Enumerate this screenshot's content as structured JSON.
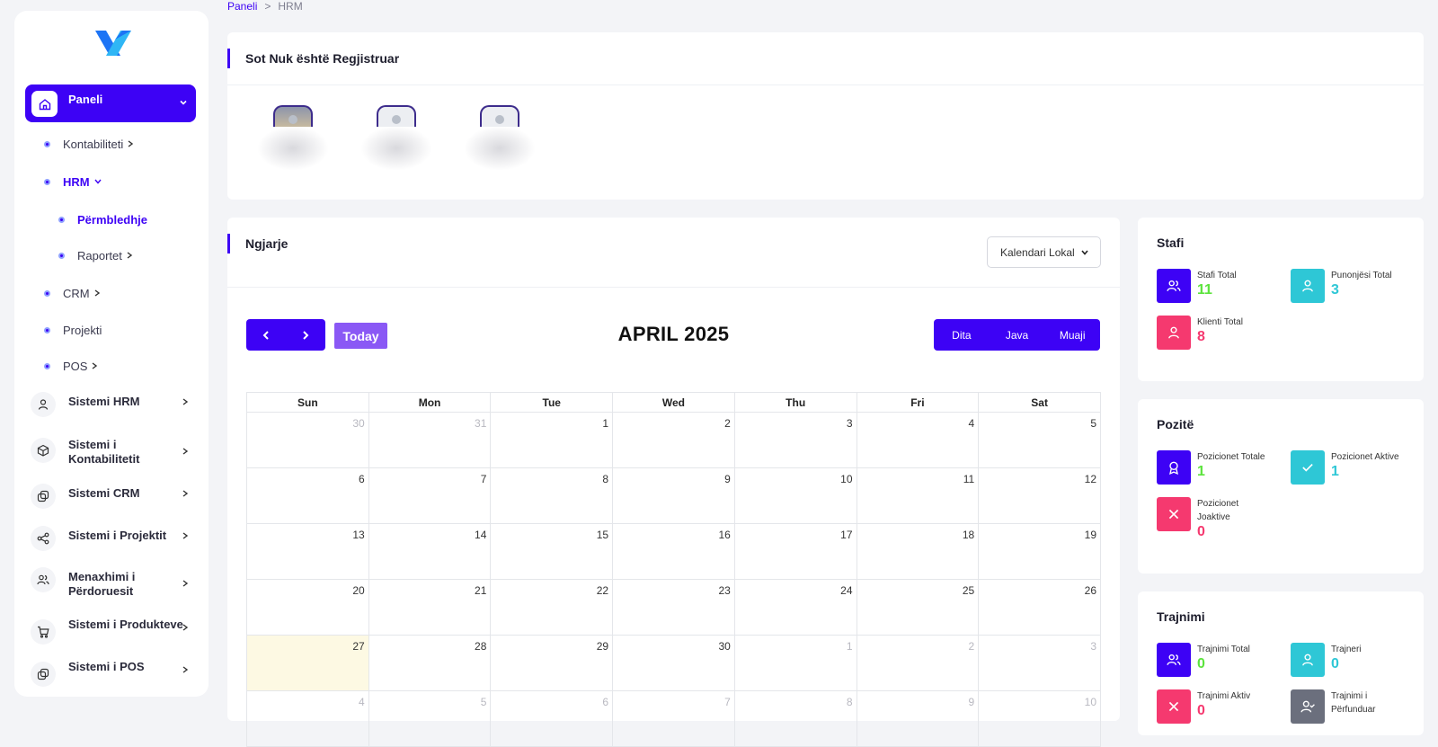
{
  "breadcrumb": {
    "root": "Paneli",
    "sep": ">",
    "current": "HRM"
  },
  "sidebar": {
    "active": "Paneli",
    "subitems": [
      "Kontabiliteti",
      "HRM",
      "Përmbledhje",
      "Raportet",
      "CRM",
      "Projekti",
      "POS"
    ],
    "systems": [
      "Sistemi HRM",
      "Sistemi i Kontabilitetit",
      "Sistemi CRM",
      "Sistemi i Projektit",
      "Menaxhimi i Përdoruesit",
      "Sistemi i Produkteve",
      "Sistemi i POS"
    ]
  },
  "registered": {
    "title": "Sot Nuk është Regjistruar"
  },
  "events": {
    "title": "Ngjarje",
    "calendar_select": "Kalendari Lokal",
    "today": "Today",
    "month": "APRIL 2025",
    "views": [
      "Dita",
      "Java",
      "Muaji"
    ],
    "weekdays": [
      "Sun",
      "Mon",
      "Tue",
      "Wed",
      "Thu",
      "Fri",
      "Sat"
    ],
    "weeks": [
      [
        "30",
        "31",
        "1",
        "2",
        "3",
        "4",
        "5"
      ],
      [
        "6",
        "7",
        "8",
        "9",
        "10",
        "11",
        "12"
      ],
      [
        "13",
        "14",
        "15",
        "16",
        "17",
        "18",
        "19"
      ],
      [
        "20",
        "21",
        "22",
        "23",
        "24",
        "25",
        "26"
      ],
      [
        "27",
        "28",
        "29",
        "30",
        "1",
        "2",
        "3"
      ],
      [
        "4",
        "5",
        "6",
        "7",
        "8",
        "9",
        "10"
      ]
    ]
  },
  "stafi": {
    "title": "Stafi",
    "items": [
      {
        "label": "Stafi Total",
        "value": "11"
      },
      {
        "label": "Punonjësi Total",
        "value": "3"
      },
      {
        "label": "Klienti Total",
        "value": "8"
      }
    ]
  },
  "pozite": {
    "title": "Pozitë",
    "items": [
      {
        "label": "Pozicionet Totale",
        "value": "1"
      },
      {
        "label": "Pozicionet Aktive",
        "value": "1"
      },
      {
        "label": "Pozicionet Joaktive",
        "value": "0"
      }
    ]
  },
  "trajnimi": {
    "title": "Trajnimi",
    "items": [
      {
        "label": "Trajnimi Total",
        "value": "0"
      },
      {
        "label": "Trajneri",
        "value": "0"
      },
      {
        "label": "Trajnimi Aktiv",
        "value": "0"
      },
      {
        "label": "Trajnimi i Përfunduar",
        "value": ""
      }
    ]
  },
  "colors": {
    "primary": "#3d02f5",
    "teal": "#2ec7d6",
    "red": "#f5396f",
    "green": "#5ce33d",
    "gray": "#6b6f7d",
    "today_bg": "#fdf9e3"
  }
}
